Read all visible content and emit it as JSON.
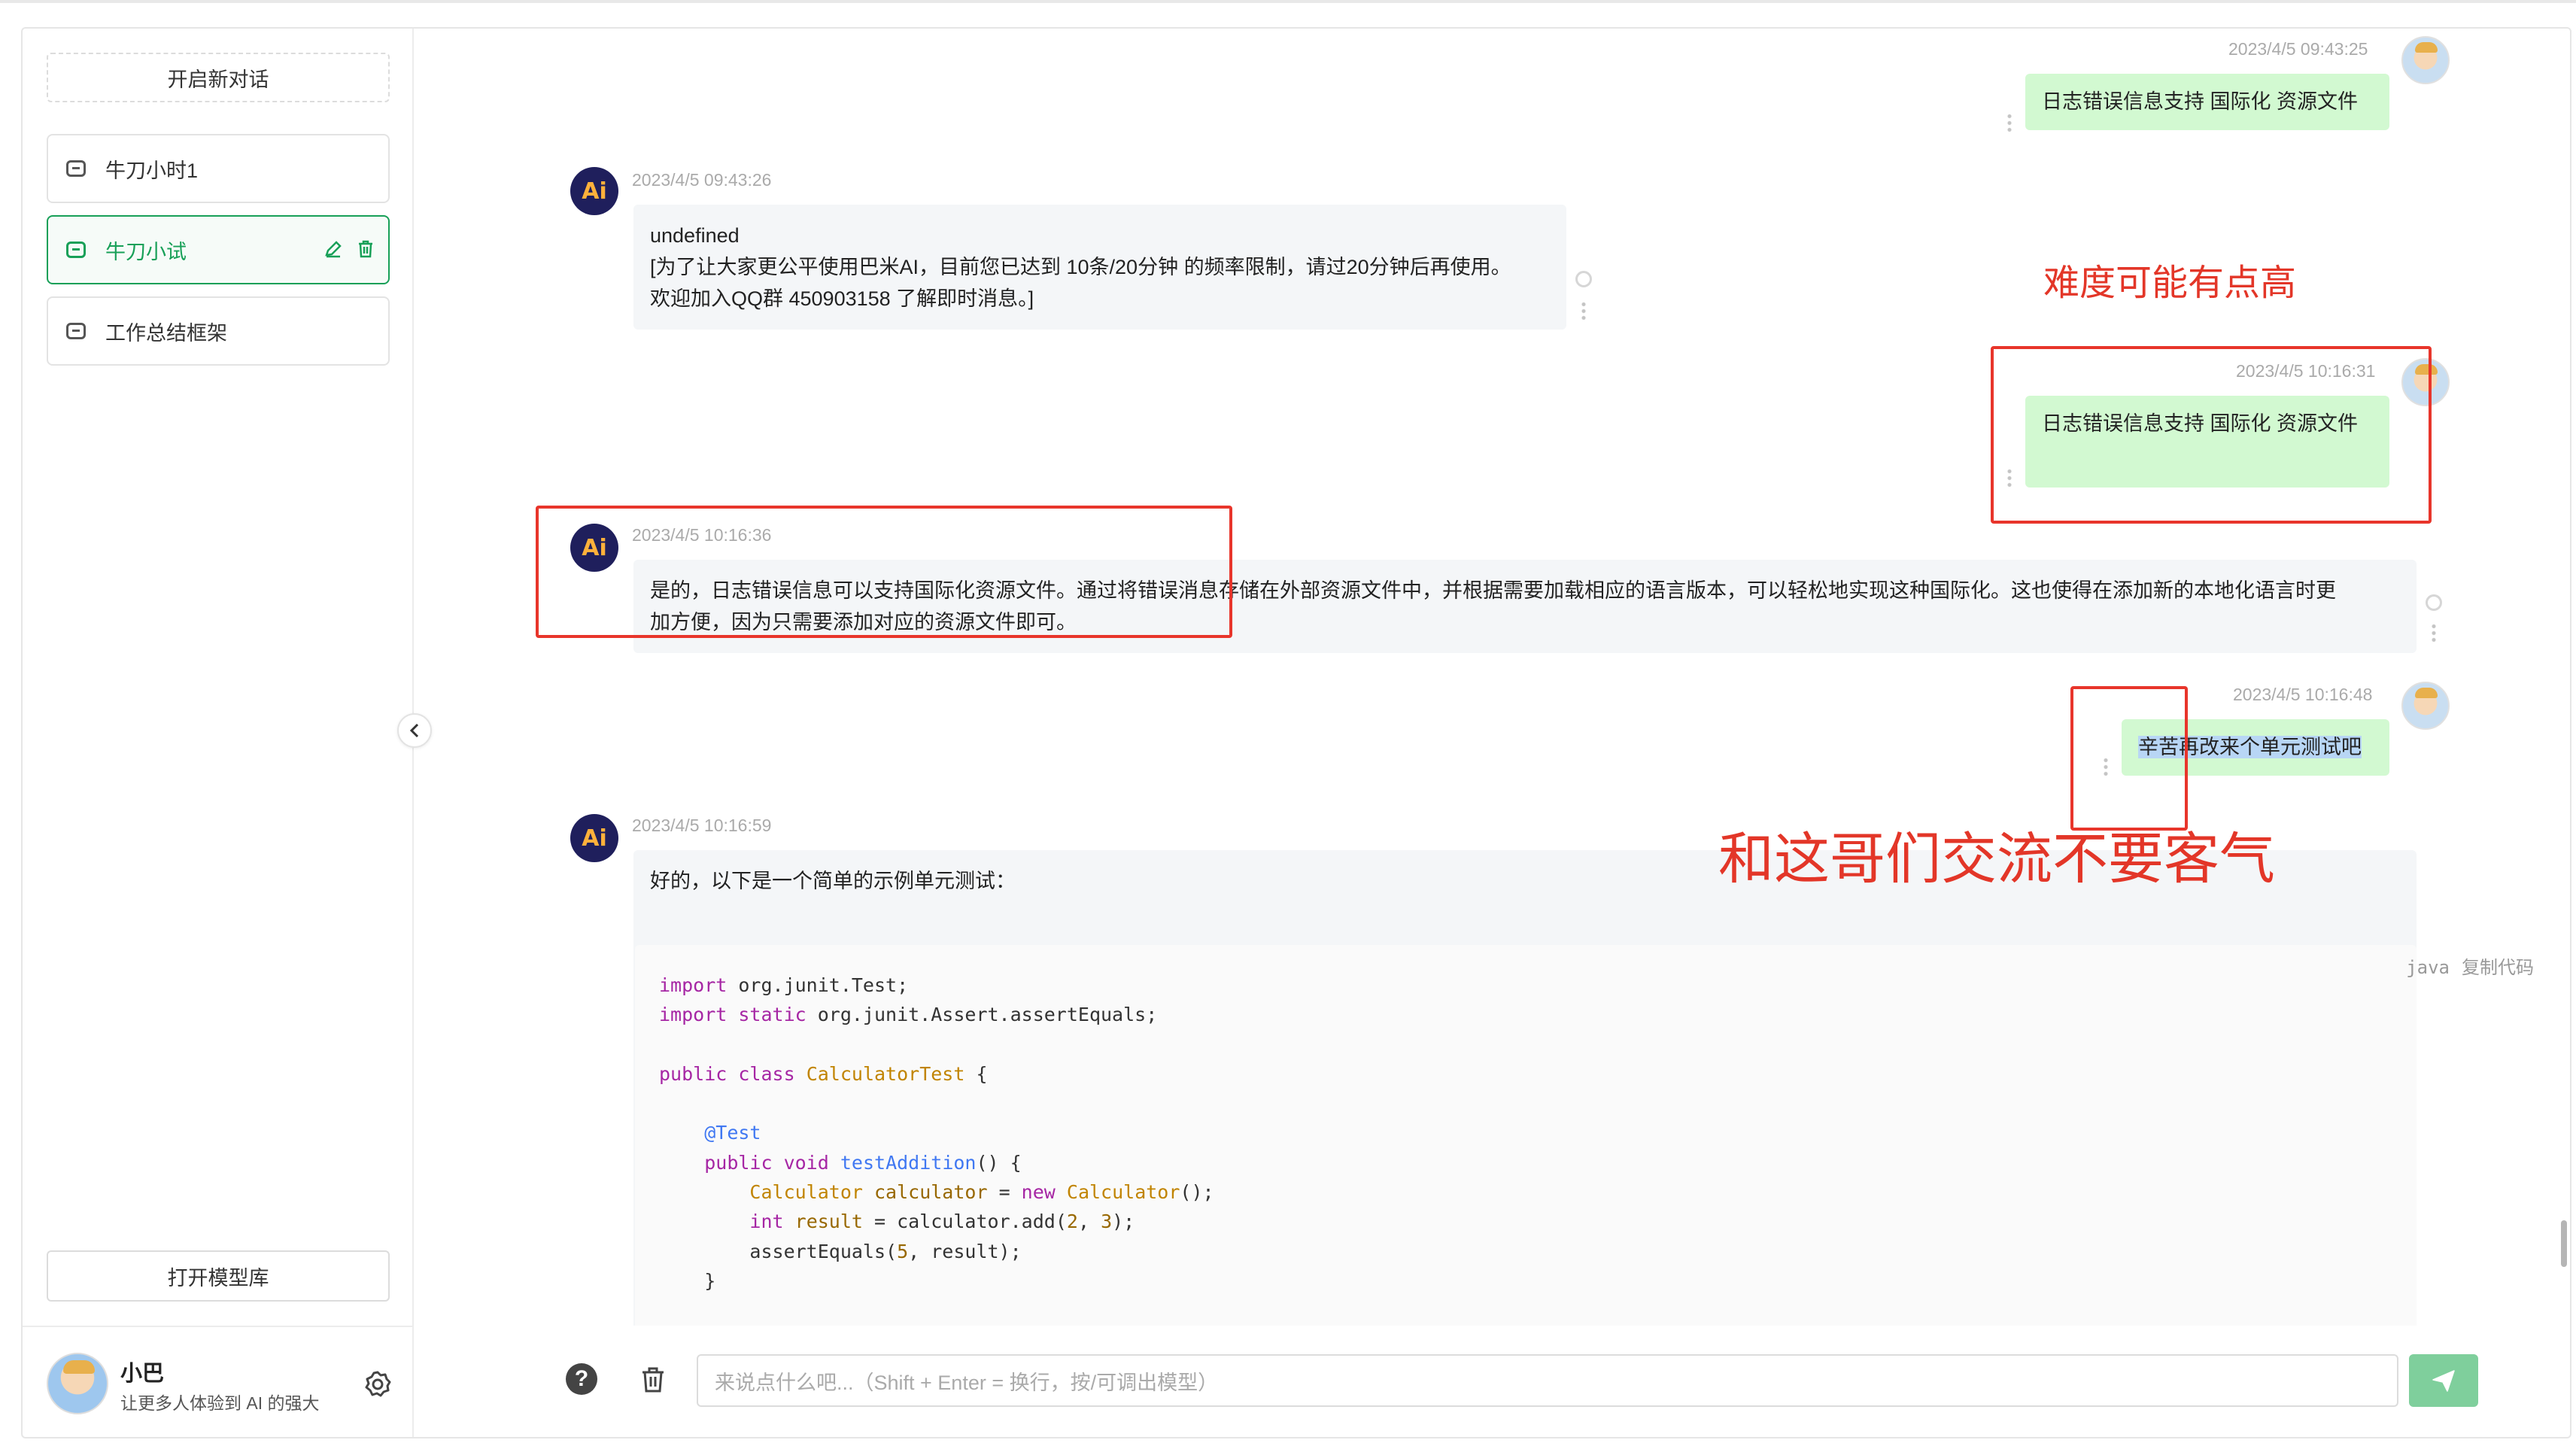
{
  "sidebar": {
    "new_chat": "开启新对话",
    "conversations": [
      {
        "label": "牛刀小时1",
        "active": false
      },
      {
        "label": "牛刀小试",
        "active": true
      },
      {
        "label": "工作总结框架",
        "active": false
      }
    ],
    "open_model_library": "打开模型库",
    "user": {
      "name": "小巴",
      "description": "让更多人体验到 AI 的强大"
    }
  },
  "messages": [
    {
      "role": "user",
      "time": "2023/4/5 09:43:25",
      "text": "日志错误信息支持 国际化 资源文件"
    },
    {
      "role": "ai",
      "time": "2023/4/5 09:43:26",
      "lines": [
        "undefined",
        "[为了让大家更公平使用巴米AI，目前您已达到 10条/20分钟 的频率限制，请过20分钟后再使用。",
        "欢迎加入QQ群 450903158 了解即时消息。]"
      ]
    },
    {
      "role": "user",
      "time": "2023/4/5 10:16:31",
      "text": "日志错误信息支持 国际化 资源文件"
    },
    {
      "role": "ai",
      "time": "2023/4/5 10:16:36",
      "lines": [
        "是的，日志错误信息可以支持国际化资源文件。通过将错误消息存储在外部资源文件中，并根据需要加载相应的语言版本，可以轻松地实现这种国际化。这也使得在添加新的本地化语言时更",
        "加方便，因为只需要添加对应的资源文件即可。"
      ]
    },
    {
      "role": "user",
      "time": "2023/4/5 10:16:48",
      "text": "辛苦再改来个单元测试吧"
    },
    {
      "role": "ai",
      "time": "2023/4/5 10:16:59",
      "intro": "好的，以下是一个简单的示例单元测试：",
      "code_lang": "java",
      "copy_label": "复制代码"
    }
  ],
  "annotations": {
    "difficulty": "难度可能有点高",
    "polite": "和这哥们交流不要客气"
  },
  "input": {
    "placeholder": "来说点什么吧...（Shift + Enter = 换行，按/可调出模型）"
  },
  "colors": {
    "accent": "#18a058",
    "user_bubble": "#d2f9d1",
    "ai_bubble": "#f4f6f8",
    "annotation_red": "#e33628"
  }
}
